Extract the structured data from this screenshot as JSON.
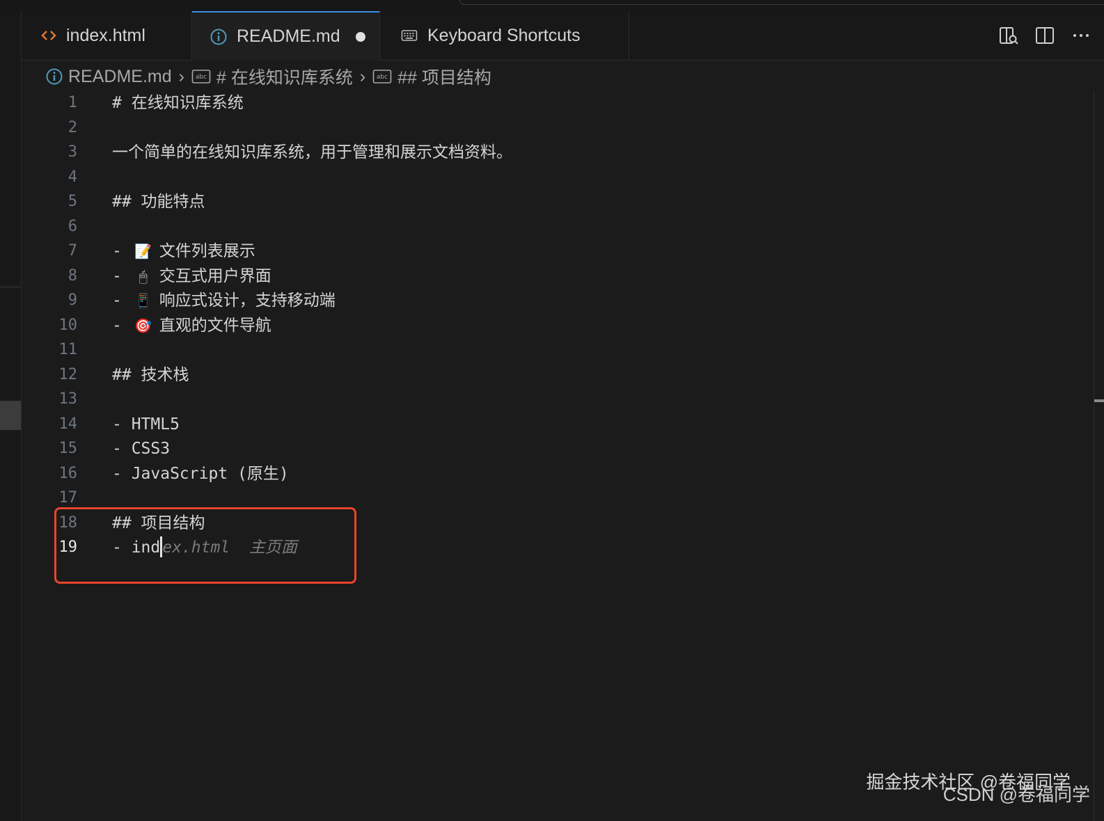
{
  "tabs": [
    {
      "label": "index.html",
      "icon": "html-brackets-icon",
      "icon_color": "#e37933"
    },
    {
      "label": "README.md",
      "icon": "info-icon",
      "icon_color": "#519aba",
      "active": true,
      "modified": true
    },
    {
      "label": "Keyboard Shortcuts",
      "icon": "keyboard-icon",
      "icon_color": "#bbbbbb"
    }
  ],
  "breadcrumb": [
    {
      "label": "README.md",
      "icon": "info-icon"
    },
    {
      "label": "# 在线知识库系统",
      "icon": "abc-symbol-icon"
    },
    {
      "label": "## 项目结构",
      "icon": "abc-symbol-icon"
    }
  ],
  "editor": {
    "active_line": 19,
    "lines": [
      {
        "n": "1",
        "text": "# 在线知识库系统"
      },
      {
        "n": "2",
        "text": ""
      },
      {
        "n": "3",
        "text": "一个简单的在线知识库系统，用于管理和展示文档资料。"
      },
      {
        "n": "4",
        "text": ""
      },
      {
        "n": "5",
        "text": "## 功能特点"
      },
      {
        "n": "6",
        "text": ""
      },
      {
        "n": "7",
        "prefix": "- ",
        "emoji": "📝",
        "text": "文件列表展示"
      },
      {
        "n": "8",
        "prefix": "- ",
        "emoji": "🖱",
        "text": "交互式用户界面"
      },
      {
        "n": "9",
        "prefix": "- ",
        "emoji": "📱",
        "text": "响应式设计，支持移动端"
      },
      {
        "n": "10",
        "prefix": "- ",
        "emoji": "🎯",
        "text": "直观的文件导航"
      },
      {
        "n": "11",
        "text": ""
      },
      {
        "n": "12",
        "text": "## 技术栈"
      },
      {
        "n": "13",
        "text": ""
      },
      {
        "n": "14",
        "text": "- HTML5"
      },
      {
        "n": "15",
        "text": "- CSS3"
      },
      {
        "n": "16",
        "text": "- JavaScript (原生)"
      },
      {
        "n": "17",
        "text": ""
      },
      {
        "n": "18",
        "text": "## 项目结构"
      },
      {
        "n": "19",
        "typed": "- ind",
        "suggestion": "ex.html  主页面"
      }
    ]
  },
  "watermark": {
    "line1": "掘金技术社区 @卷福同学",
    "line2": "CSDN @卷福同学"
  },
  "colors": {
    "highlight_border": "#e8452a",
    "active_tab_accent": "#3a8ee6",
    "editor_bg": "#1b1b1b"
  }
}
